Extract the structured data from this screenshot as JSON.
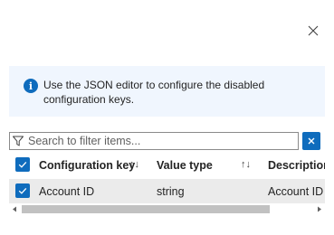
{
  "dialog": {
    "close_icon": "close-icon"
  },
  "info_bar": {
    "icon": "info-icon",
    "icon_glyph": "i",
    "message": "Use the JSON editor to configure the disabled configuration keys."
  },
  "search": {
    "placeholder": "Search to filter items...",
    "value": "",
    "filter_icon": "filter-icon",
    "clear_icon": "close-icon"
  },
  "table": {
    "select_all_checked": true,
    "columns": [
      {
        "label": "Configuration key",
        "sort_icon": "↑↓"
      },
      {
        "label": "Value type",
        "sort_icon": "↑↓"
      },
      {
        "label": "Description",
        "sort_icon": ""
      }
    ],
    "rows": [
      {
        "checked": true,
        "key": "Account ID",
        "value_type": "string",
        "description": "Account ID"
      }
    ]
  },
  "colors": {
    "accent": "#0f6cbd",
    "info_background": "#f0f6fe",
    "selected_row": "#ebebeb",
    "scroll_thumb": "#c1c1c1"
  }
}
